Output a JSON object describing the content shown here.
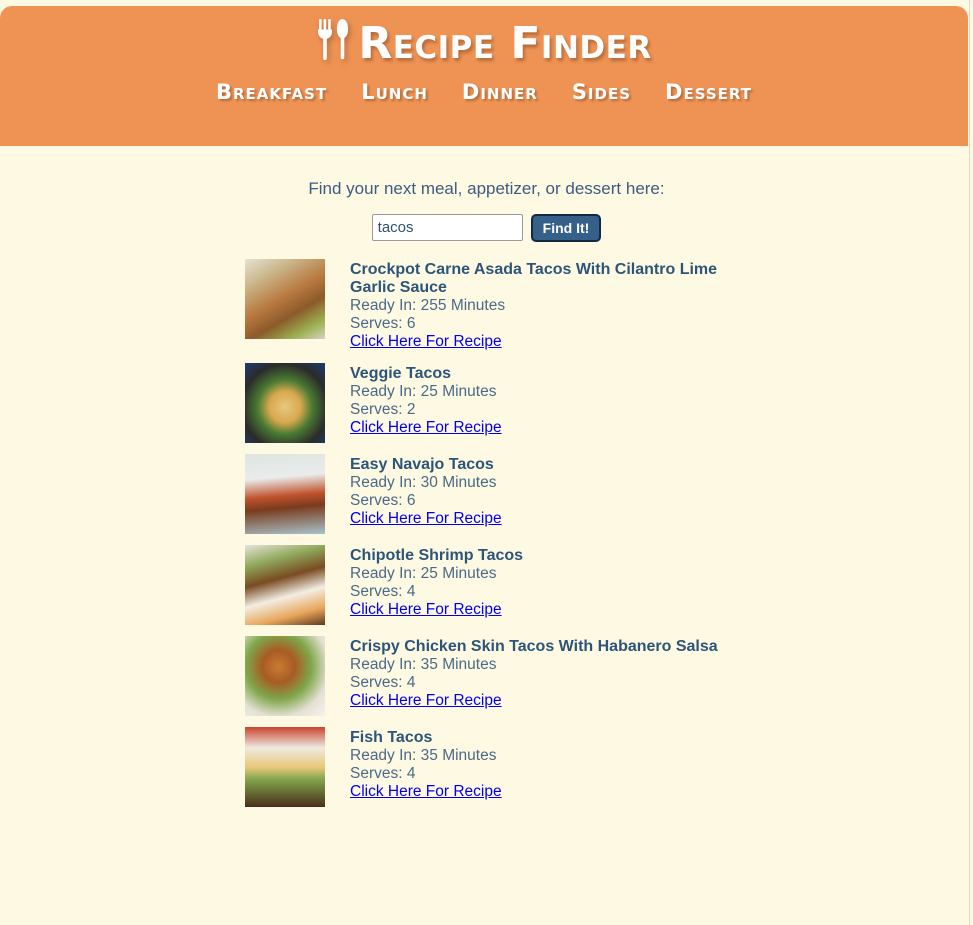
{
  "site": {
    "brand_icon": "utensils-icon",
    "brand_title": "Recipe Finder",
    "header_bg": "#ef9355",
    "page_bg": "#fdf9e3",
    "title_color": "#ffffff"
  },
  "nav": {
    "items": [
      {
        "label": "Breakfast"
      },
      {
        "label": "Lunch"
      },
      {
        "label": "Dinner"
      },
      {
        "label": "Sides"
      },
      {
        "label": "Dessert"
      }
    ]
  },
  "search": {
    "prompt": "Find your next meal, appetizer, or dessert here:",
    "value": "tacos",
    "placeholder": "",
    "button_label": "Find It!",
    "button_color": "#356089"
  },
  "results": {
    "link_label": "Click Here For Recipe",
    "link_color": "#0000ee",
    "title_color": "#2d5579",
    "items": [
      {
        "title": "Crockpot Carne Asada Tacos With Cilantro Lime Garlic Sauce",
        "ready_in": "Ready In: 255 Minutes",
        "serves": "Serves: 6",
        "link": "Click Here For Recipe",
        "thumb_alt": "crockpot-carne-asada-tacos-thumbnail"
      },
      {
        "title": "Veggie Tacos",
        "ready_in": "Ready In: 25 Minutes",
        "serves": "Serves: 2",
        "link": "Click Here For Recipe",
        "thumb_alt": "veggie-tacos-thumbnail"
      },
      {
        "title": "Easy Navajo Tacos",
        "ready_in": "Ready In: 30 Minutes",
        "serves": "Serves: 6",
        "link": "Click Here For Recipe",
        "thumb_alt": "easy-navajo-tacos-thumbnail"
      },
      {
        "title": "Chipotle Shrimp Tacos",
        "ready_in": "Ready In: 25 Minutes",
        "serves": "Serves: 4",
        "link": "Click Here For Recipe",
        "thumb_alt": "chipotle-shrimp-tacos-thumbnail"
      },
      {
        "title": "Crispy Chicken Skin Tacos With Habanero Salsa",
        "ready_in": "Ready In: 35 Minutes",
        "serves": "Serves: 4",
        "link": "Click Here For Recipe",
        "thumb_alt": "crispy-chicken-skin-tacos-thumbnail"
      },
      {
        "title": "Fish Tacos",
        "ready_in": "Ready In: 35 Minutes",
        "serves": "Serves: 4",
        "link": "Click Here For Recipe",
        "thumb_alt": "fish-tacos-thumbnail"
      }
    ]
  }
}
